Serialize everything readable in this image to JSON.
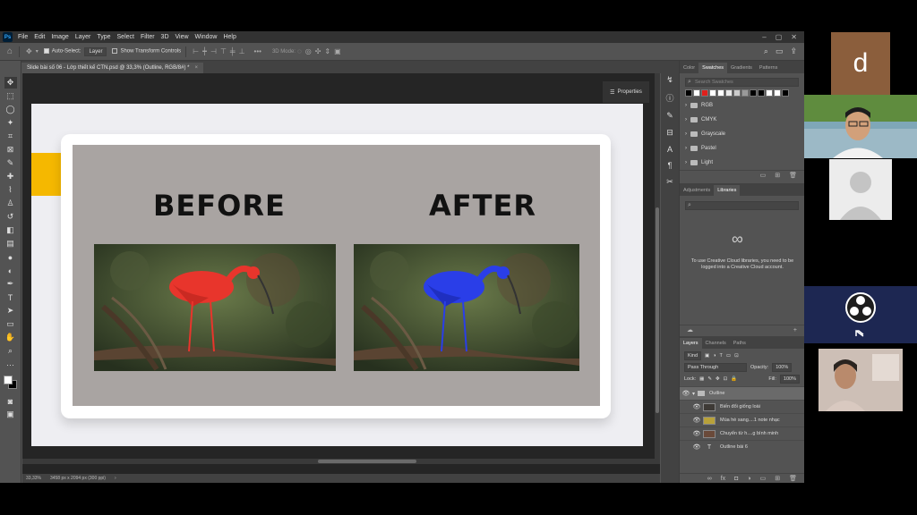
{
  "menubar": {
    "logo": "Ps",
    "items": [
      "File",
      "Edit",
      "Image",
      "Layer",
      "Type",
      "Select",
      "Filter",
      "3D",
      "View",
      "Window",
      "Help"
    ]
  },
  "options": {
    "auto_select": "Auto-Select:",
    "layer_select": "Layer",
    "show_transform": "Show Transform Controls",
    "more": "•••",
    "mode_3d": "3D Mode:"
  },
  "document_tab": {
    "title": "Slide bài số 06 - Lớp thiết kế CTN.psd @ 33,3% (Outline, RGB/8#) *",
    "close": "×"
  },
  "canvas": {
    "before_label": "BEFORE",
    "after_label": "AFTER",
    "accent_color": "#f5b800",
    "before_bird_color": "#e8352c",
    "after_bird_color": "#2a3ee8"
  },
  "properties_button": "Properties",
  "status": {
    "zoom": "33,33%",
    "doc_size": "3458 px x 2094 px (300 ppi)"
  },
  "swatches_panel": {
    "tabs": [
      "Color",
      "Swatches",
      "Gradients",
      "Patterns"
    ],
    "active_tab": "Swatches",
    "search_placeholder": "Search Swatches",
    "swatch_colors": [
      "#000000",
      "#ffffff",
      "#e0201c",
      "#ffffff",
      "#ffffff",
      "#e8e8e8",
      "#cccccc",
      "#999999",
      "#000000",
      "#000000",
      "#ffffff",
      "#ffffff",
      "#000000"
    ],
    "groups": [
      "RGB",
      "CMYK",
      "Grayscale",
      "Pastel",
      "Light"
    ]
  },
  "libraries_panel": {
    "tabs": [
      "Adjustments",
      "Libraries"
    ],
    "active_tab": "Libraries",
    "message": "To use Creative Cloud libraries, you need to be logged into a Creative Cloud account."
  },
  "layers_panel": {
    "tabs": [
      "Layers",
      "Channels",
      "Paths"
    ],
    "active_tab": "Layers",
    "kind": "Kind",
    "blend_mode": "Pass Through",
    "opacity_label": "Opacity:",
    "opacity_value": "100%",
    "lock_label": "Lock:",
    "fill_label": "Fill:",
    "fill_value": "100%",
    "layers": [
      {
        "name": "Outline",
        "type": "group",
        "selected": true
      },
      {
        "name": "Biến đổi giống loài",
        "type": "image"
      },
      {
        "name": "Mùa hè sang....1 note nhạc",
        "type": "image"
      },
      {
        "name": "Chuyển từ h....g bình minh",
        "type": "image"
      },
      {
        "name": "Outline bài 6",
        "type": "text"
      }
    ]
  },
  "video_call": {
    "tile1_letter": "d"
  }
}
